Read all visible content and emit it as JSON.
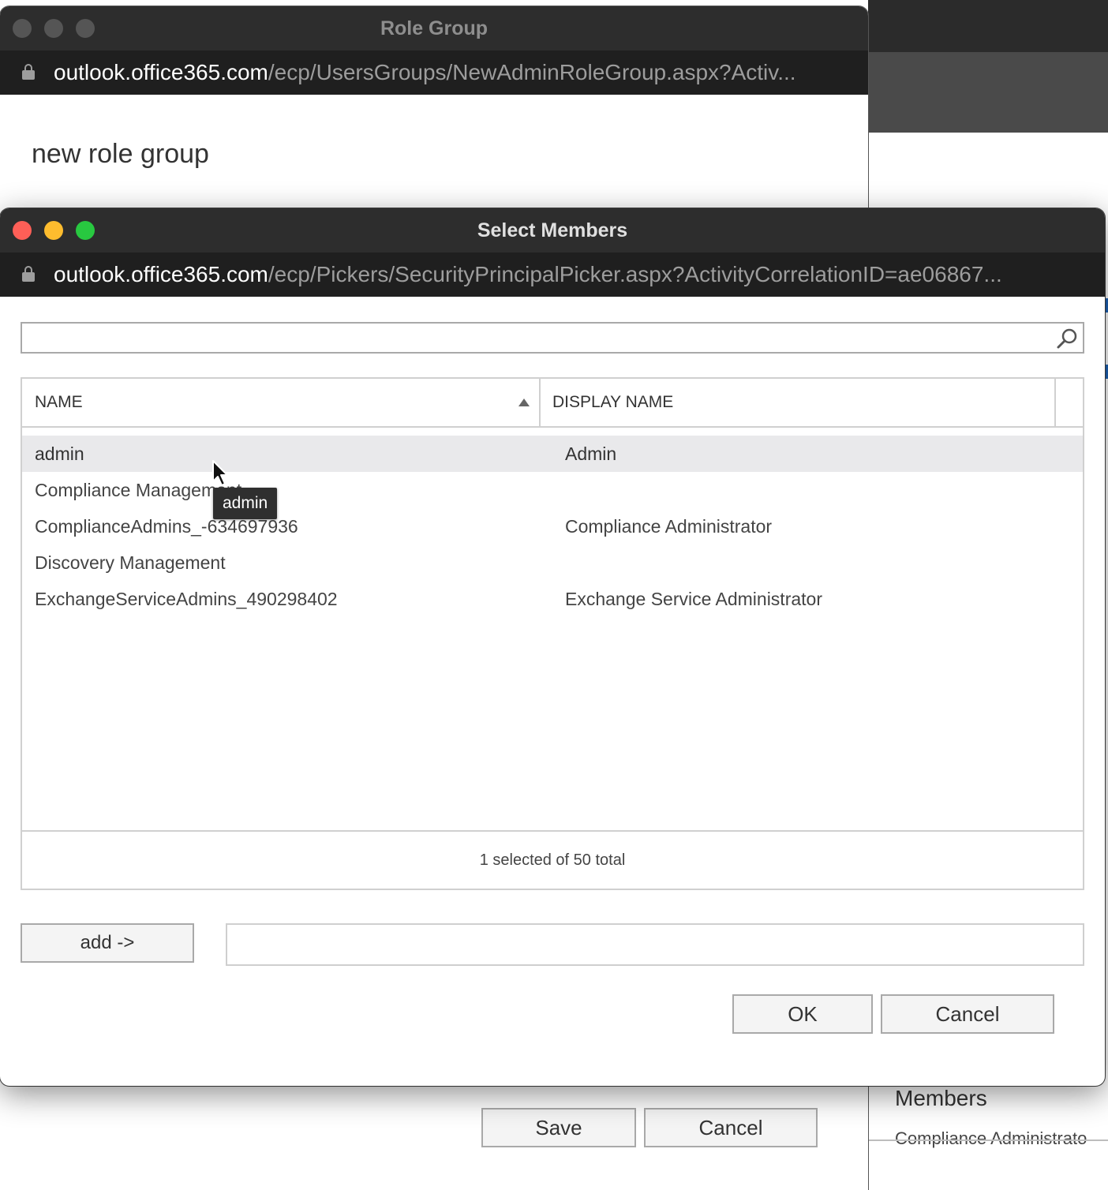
{
  "background_app": {
    "members_heading": "Members",
    "member_item": "Compliance Administrato"
  },
  "role_group_window": {
    "title": "Role Group",
    "url_domain": "outlook.office365.com",
    "url_path": "/ecp/UsersGroups/NewAdminRoleGroup.aspx?Activ...",
    "heading": "new role group",
    "save_label": "Save",
    "cancel_label": "Cancel"
  },
  "select_members_window": {
    "title": "Select Members",
    "url_domain": "outlook.office365.com",
    "url_path": "/ecp/Pickers/SecurityPrincipalPicker.aspx?ActivityCorrelationID=ae06867...",
    "search": {
      "value": "",
      "placeholder": ""
    },
    "columns": {
      "name": "NAME",
      "display_name": "DISPLAY NAME"
    },
    "rows": [
      {
        "name": "admin",
        "display_name": "Admin",
        "selected": true
      },
      {
        "name": "Compliance Management",
        "display_name": "",
        "selected": false
      },
      {
        "name": "ComplianceAdmins_-634697936",
        "display_name": "Compliance Administrator",
        "selected": false
      },
      {
        "name": "Discovery Management",
        "display_name": "",
        "selected": false
      },
      {
        "name": "ExchangeServiceAdmins_490298402",
        "display_name": "Exchange Service Administrator",
        "selected": false
      }
    ],
    "status": "1 selected of 50 total",
    "add_label": "add ->",
    "ok_label": "OK",
    "cancel_label": "Cancel",
    "tooltip": "admin"
  }
}
